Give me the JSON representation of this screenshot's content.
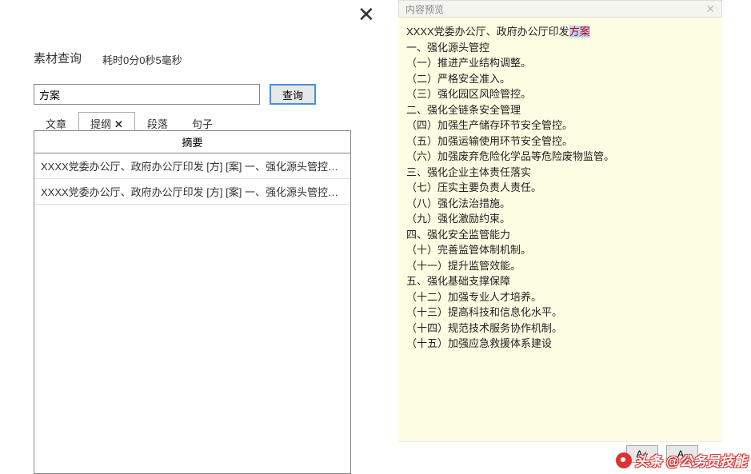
{
  "leftPanel": {
    "queryTitle": "素材查询",
    "timeInfo": "耗时0分0秒5毫秒",
    "searchValue": "方案",
    "searchBtnLabel": "查询",
    "tabs": [
      {
        "label": "文章",
        "active": false,
        "closable": false
      },
      {
        "label": "提纲",
        "active": true,
        "closable": true
      },
      {
        "label": "段落",
        "active": false,
        "closable": false
      },
      {
        "label": "句子",
        "active": false,
        "closable": false
      }
    ],
    "resultsHeader": "摘要",
    "results": [
      "XXXX党委办公厅、政府办公厅印发 [方] [案] 一、强化源头管控（一…",
      "XXXX党委办公厅、政府办公厅印发 [方] [案] 一、强化源头管控（一…"
    ]
  },
  "rightPanel": {
    "titleBar": "内容预览",
    "titleLinePrefix": "XXXX党委办公厅、政府办公厅印发",
    "titleLineHighlight": "方案",
    "lines": [
      "一、强化源头管控",
      "（一）推进产业结构调整。",
      "（二）严格安全准入。",
      "（三）强化园区风险管控。",
      "二、强化全链条安全管理",
      "（四）加强生产储存环节安全管控。",
      "（五）加强运输使用环节安全管控。",
      "（六）加强废弃危险化学品等危险废物监管。",
      "三、强化企业主体责任落实",
      "（七）压实主要负责人责任。",
      "（八）强化法治措施。",
      "（九）强化激励约束。",
      "四、强化安全监管能力",
      "（十）完善监管体制机制。",
      "（十一）提升监管效能。",
      "五、强化基础支撑保障",
      "（十二）加强专业人才培养。",
      "（十三）提高科技和信息化水平。",
      "（十四）规范技术服务协作机制。",
      "（十五）加强应急救援体系建设"
    ],
    "fontIncrease": "A+",
    "fontDecrease": "A-"
  },
  "watermark": "头条 @公务员技能"
}
